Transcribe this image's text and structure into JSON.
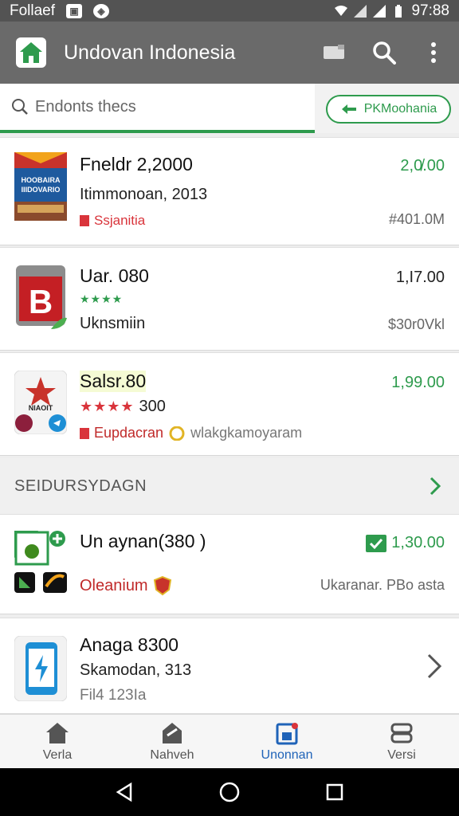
{
  "status_bar": {
    "carrier": "Follaef",
    "time": "97:88"
  },
  "app_bar": {
    "title": "Undovan Indonesia"
  },
  "search": {
    "placeholder": "Endonts thecs",
    "filter_label": "PKMoohania"
  },
  "items": [
    {
      "title": "Fneldr 2,2000",
      "subtitle": "Itimmonoan, 2013",
      "price": "2,0̸.00",
      "tag": "Ssjanitia",
      "meta": "#401.0M",
      "thumb_text": "HOOBAIRA\nIIIDOVARIO"
    },
    {
      "title": "Uar. 080",
      "rating_stars": "★★★★",
      "subtitle": "Uknsmiin",
      "price": "1,I7.00",
      "meta": "$30r0Vkl",
      "thumb_letter": "B"
    },
    {
      "title": "Salsr.80",
      "rating_stars": "★★★★",
      "rating_count": "300",
      "price": "1,99.00",
      "tag": "Eupdacran",
      "tag2": "wlakgkamoyaram",
      "thumb_text": "NIAOIT"
    }
  ],
  "section": {
    "title": "SEIDURSYDAGN"
  },
  "section_items": [
    {
      "title": "Un aynan(380 )",
      "price": "1,30.00",
      "tag": "Oleanium",
      "meta": "Ukaranar. PBo asta"
    },
    {
      "title": "Anaga 8300",
      "subtitle": "Skamodan, 313",
      "meta": "Fil4 123Ia"
    }
  ],
  "bottom_nav": [
    {
      "label": "Verla",
      "icon": "home-icon",
      "active": false
    },
    {
      "label": "Nahveh",
      "icon": "store-icon",
      "active": false
    },
    {
      "label": "Unonnan",
      "icon": "calendar-icon",
      "active": true
    },
    {
      "label": "Versi",
      "icon": "settings-icon",
      "active": false
    }
  ],
  "colors": {
    "accent": "#2e9b4d",
    "appbar": "#6a6a6a",
    "active_nav": "#1f63b8",
    "tag_red": "#d9343b"
  }
}
